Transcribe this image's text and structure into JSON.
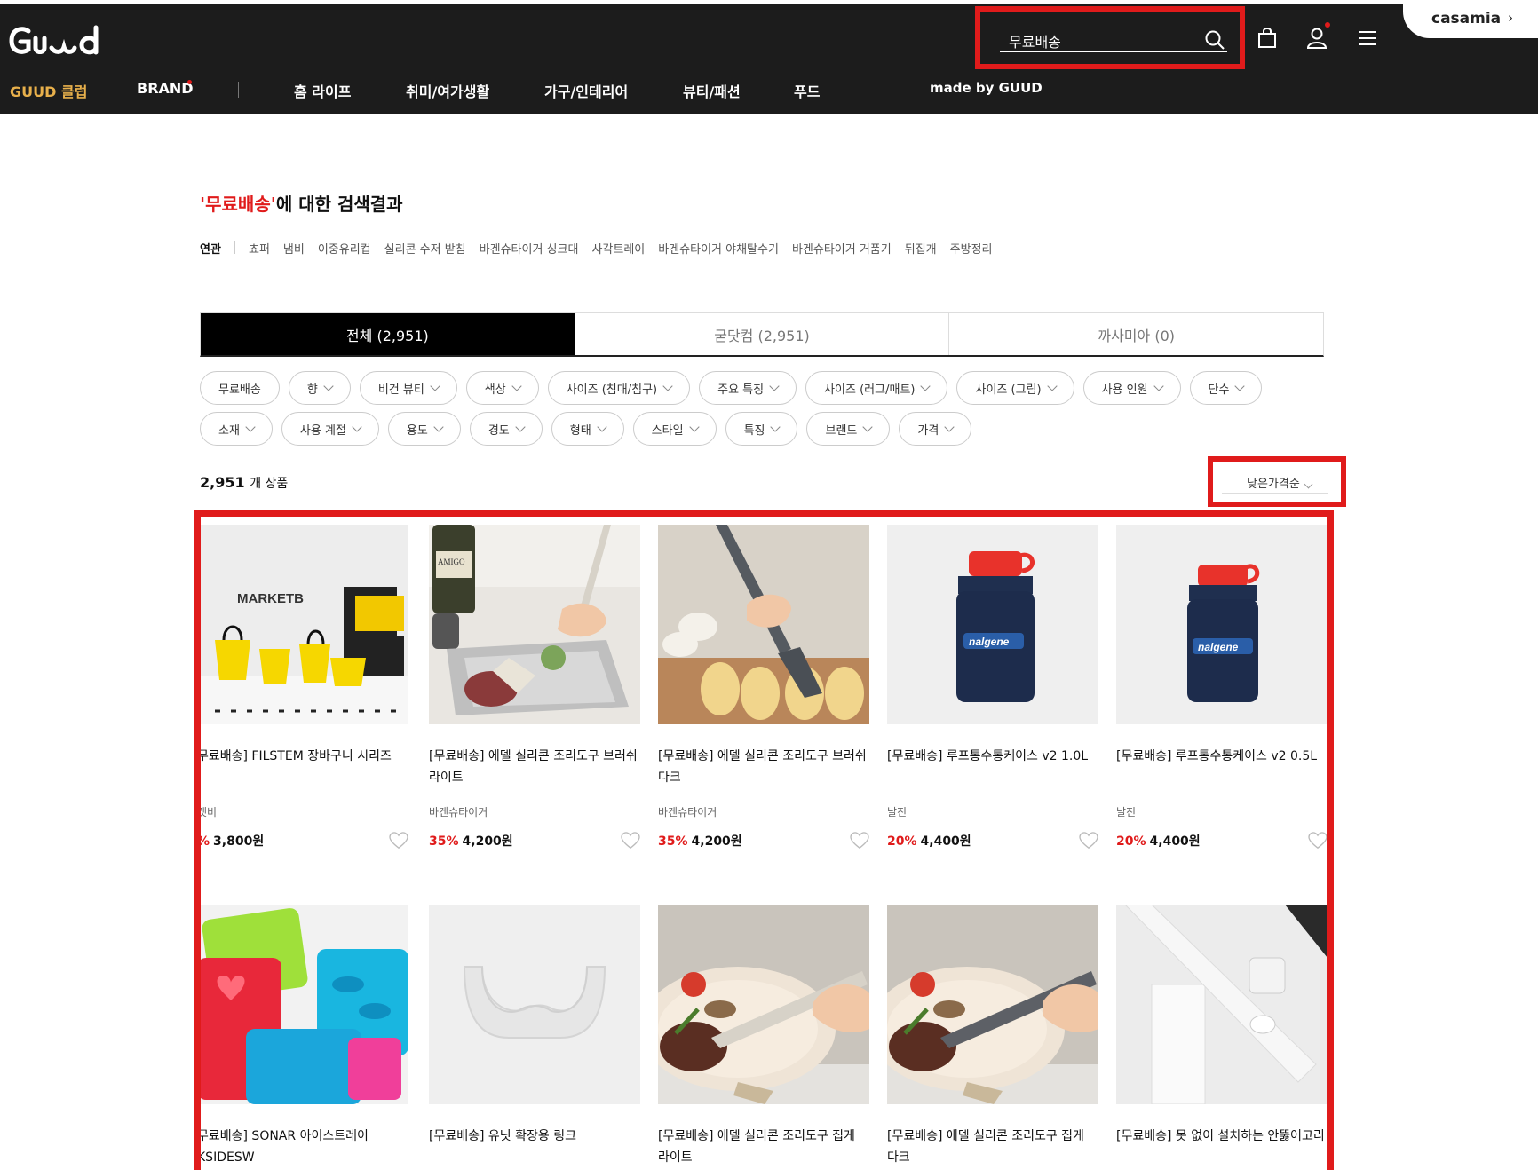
{
  "header": {
    "logo_text": "Guud",
    "search_query": "무료배송",
    "casamia_label": "casamia",
    "nav": [
      "GUUD 클럽",
      "BRAND",
      "홈 라이프",
      "취미/여가생활",
      "가구/인테리어",
      "뷰티/패션",
      "푸드",
      "made by GUUD"
    ]
  },
  "results": {
    "keyword": "'무료배송'",
    "title_suffix": "에 대한 검색결과",
    "related_label": "연관",
    "related": [
      "쵸퍼",
      "냄비",
      "이중유리컵",
      "실리콘 수저 받침",
      "바겐슈타이거 싱크대",
      "사각트레이",
      "바겐슈타이거 야채탈수기",
      "바겐슈타이거 거품기",
      "뒤집개",
      "주방정리"
    ],
    "tabs": [
      "전체 (2,951)",
      "굳닷컴 (2,951)",
      "까사미아 (0)"
    ],
    "filters_row1": [
      "무료배송",
      "향",
      "비건 뷰티",
      "색상",
      "사이즈 (침대/침구)",
      "주요 특징",
      "사이즈 (러그/매트)",
      "사이즈 (그림)",
      "사용 인원",
      "단수"
    ],
    "filters_row2": [
      "소재",
      "사용 계절",
      "용도",
      "경도",
      "형태",
      "스타일",
      "특징",
      "브랜드",
      "가격"
    ],
    "count_num": "2,951",
    "count_unit": "개 상품",
    "sort": "낮은가격순"
  },
  "products": [
    {
      "name": "무료배송] FILSTEM 장바구니 시리즈",
      "brand": "켓비",
      "discount": "%",
      "price": "3,800원"
    },
    {
      "name": "[무료배송] 에델 실리콘 조리도구 브러쉬 라이트",
      "brand": "바겐슈타이거",
      "discount": "35%",
      "price": "4,200원"
    },
    {
      "name": "[무료배송] 에델 실리콘 조리도구 브러쉬 다크",
      "brand": "바겐슈타이거",
      "discount": "35%",
      "price": "4,200원"
    },
    {
      "name": "[무료배송] 루프통수통케이스 v2 1.0L",
      "brand": "날진",
      "discount": "20%",
      "price": "4,400원"
    },
    {
      "name": "[무료배송] 루프통수통케이스 v2 0.5L",
      "brand": "날진",
      "discount": "20%",
      "price": "4,400원"
    },
    {
      "name": "무료배송] SONAR 아이스트레이 KSIDESW",
      "brand": "",
      "discount": "",
      "price": ""
    },
    {
      "name": "[무료배송] 유닛 확장용 링크",
      "brand": "",
      "discount": "",
      "price": ""
    },
    {
      "name": "[무료배송] 에델 실리콘 조리도구 집게 라이트",
      "brand": "",
      "discount": "",
      "price": ""
    },
    {
      "name": "[무료배송] 에델 실리콘 조리도구 집게 다크",
      "brand": "",
      "discount": "",
      "price": ""
    },
    {
      "name": "[무료배송] 못 없이 설치하는 안뚫어고리",
      "brand": "",
      "discount": "",
      "price": ""
    }
  ],
  "image_text": {
    "marketb": "MARKETB",
    "amigo": "AMIGO",
    "nalgene": "nalgene"
  }
}
